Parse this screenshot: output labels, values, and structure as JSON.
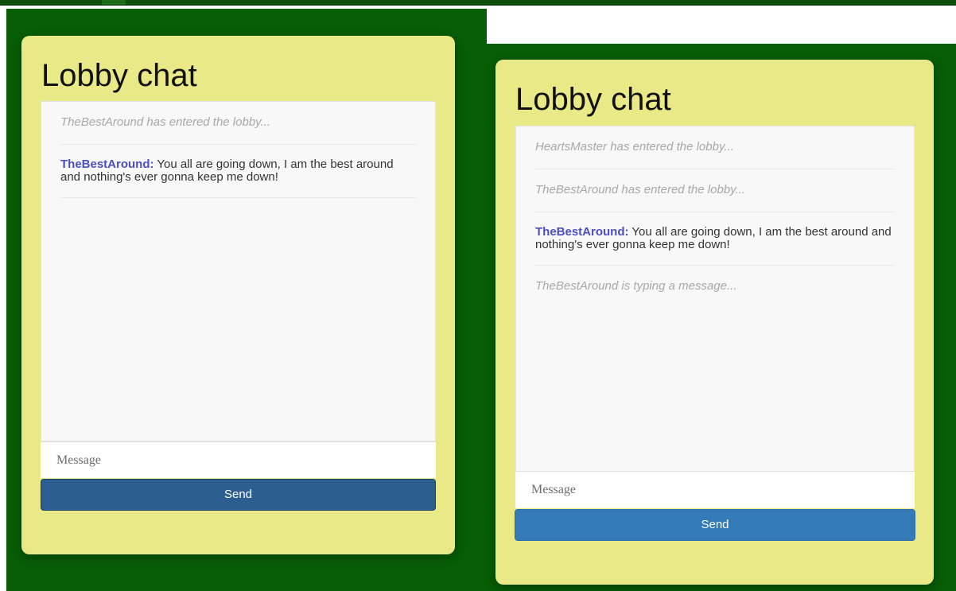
{
  "colors": {
    "page_background": "#075e05",
    "panel_background": "#e9ea87",
    "author_name": "#4b4fc2",
    "system_text": "#a8a8a8",
    "send_button_pressed": "#2c5f8f",
    "send_button": "#337ab7"
  },
  "left_panel": {
    "title": "Lobby chat",
    "messages": [
      {
        "type": "system",
        "text": "TheBestAround has entered the lobby..."
      },
      {
        "type": "chat",
        "author": "TheBestAround:",
        "text": " You all are going down, I am the best around and nothing's ever gonna keep me down!"
      }
    ],
    "input_placeholder": "Message",
    "send_label": "Send"
  },
  "right_panel": {
    "title": "Lobby chat",
    "messages": [
      {
        "type": "system",
        "text": "HeartsMaster has entered the lobby..."
      },
      {
        "type": "system",
        "text": "TheBestAround has entered the lobby..."
      },
      {
        "type": "chat",
        "author": "TheBestAround:",
        "text": " You all are going down, I am the best around and nothing's ever gonna keep me down!"
      },
      {
        "type": "typing",
        "text": "TheBestAround is typing a message..."
      }
    ],
    "input_placeholder": "Message",
    "send_label": "Send"
  }
}
